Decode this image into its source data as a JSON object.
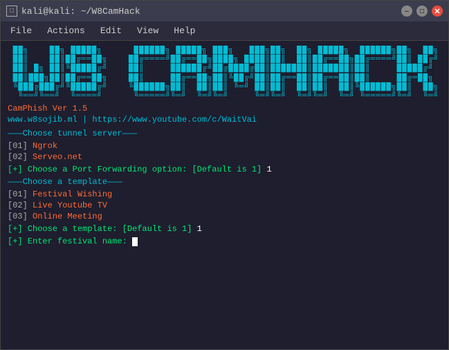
{
  "window": {
    "title": "kali@kali: ~/W8CamHack",
    "icon": "□"
  },
  "titlebar": {
    "controls": {
      "minimize": "–",
      "maximize": "□",
      "close": "✕"
    }
  },
  "menubar": {
    "items": [
      "File",
      "Actions",
      "Edit",
      "View",
      "Help"
    ]
  },
  "terminal": {
    "ascii_art": [
      " ██╗    ██╗ █████╗      ██████╗ █████╗ ███╗   ███╗██╗  ██╗ █████╗  ██████╗██╗  ██╗",
      " ██║    ██║██╔══██╗    ██╔════╝██╔══██╗████╗ ████║██║  ██║██╔══██╗██╔════╝██║ ██╔╝",
      " ██║ █╗ ██║╚█████╔╝    ██║     ███████║██╔████╔██║███████║███████║██║     █████╔╝ ",
      " ██║███╗██║██╔══██╗    ██║     ██╔══██║██║╚██╔╝██║██╔══██║██╔══██║██║     ██╔═██╗ ",
      " ╚███╔███╔╝╚█████╔╝    ╚██████╗██║  ██║██║ ╚═╝ ██║██║  ██║██║  ██║╚██████╗██║  ██╗",
      "  ╚══╝╚══╝  ╚════╝      ╚═════╝╚═╝  ╚═╝╚═╝     ╚═╝╚═╝  ╚═╝╚═╝  ╚═╝ ╚═════╝╚═╝  ╚═╝"
    ],
    "version": "CamPhish Ver 1.5",
    "website": "www.w8sojib.ml | https://www.youtube.com/c/WaitVai",
    "tunnel_section": {
      "divider": "———Choose tunnel server———",
      "options": [
        {
          "num": "01",
          "label": "Ngrok"
        },
        {
          "num": "02",
          "label": "Serveo.net"
        }
      ]
    },
    "port_prompt": "[+] Choose a Port Forwarding option: [Default is 1] 1",
    "template_section": {
      "divider": "———Choose a template———",
      "options": [
        {
          "num": "01",
          "label": "Festival Wishing"
        },
        {
          "num": "02",
          "label": "Live Youtube TV"
        },
        {
          "num": "03",
          "label": "Online Meeting"
        }
      ]
    },
    "template_prompt": "[+] Choose a template: [Default is 1] 1",
    "festival_prompt": "[+] Enter festival name: "
  }
}
